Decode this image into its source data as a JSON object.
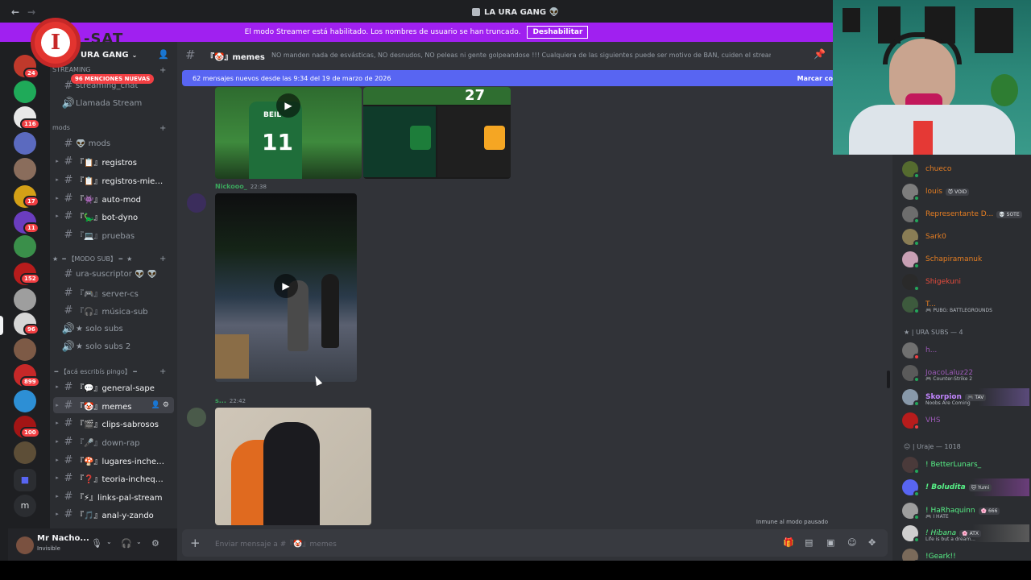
{
  "window": {
    "title": "LA URA GANG 👽"
  },
  "streamer_banner": {
    "text": "El modo Streamer está habilitado. Los nombres de usuario se han truncado.",
    "button": "Deshabilitar"
  },
  "logo": {
    "mark": "I",
    "text": "-SAT"
  },
  "servers": [
    {
      "badge": "24"
    },
    {
      "badge": ""
    },
    {
      "badge": "116"
    },
    {
      "badge": ""
    },
    {
      "badge": ""
    },
    {
      "badge": "17"
    },
    {
      "badge": "11"
    },
    {
      "badge": ""
    },
    {
      "badge": "152"
    },
    {
      "badge": ""
    },
    {
      "badge": "96"
    },
    {
      "badge": ""
    },
    {
      "badge": "899"
    },
    {
      "badge": ""
    },
    {
      "badge": "100"
    },
    {
      "badge": ""
    },
    {
      "badge": ""
    },
    {
      "badge": "m"
    }
  ],
  "server_name": "URA GANG",
  "mentions_pill": "96 MENCIONES NUEVAS",
  "categories": {
    "streaming": "STREAMING",
    "mods": "mods",
    "modo_sub": "★ ╺╸【MODO SUB】╺╸ ★",
    "aca": "╺╸【acá escribís pingo】╺╸"
  },
  "channels": {
    "streaming_chat": "streaming_chat",
    "llamada": "Llamada Stream",
    "mods": "👽 mods",
    "registros": "『📋』registros",
    "registros_miem": "『📋』registros-miem...",
    "auto_mod": "『👾』auto-mod",
    "bot_dyno": "『🦕』bot-dyno",
    "pruebas": "『💻』pruebas",
    "ura_suscriptor": "ura-suscriptor 👽 👽",
    "server_cs": "『🎮』server-cs",
    "musica_sub": "『🎧』música-sub",
    "solo_subs": "★ solo subs",
    "solo_subs_2": "★ solo subs 2",
    "general_sape": "『💬』general-sape",
    "memes": "『🤡』memes",
    "clips": "『🎬』clips-sabrosos",
    "down_rap": "『🎤』down-rap",
    "lugares": "『🍄』lugares-inchequ...",
    "teoria": "『❓』teoria-inchequea...",
    "links": "『⚡』links-pal-stream",
    "anal": "『🎵』anal-y-zando"
  },
  "user": {
    "name": "Mr Nacho...",
    "status": "Invisible"
  },
  "channel_header": {
    "name": "『🤡』memes",
    "topic": "NO manden nada de esvásticas, NO desnudos, NO peleas ni gente golpeandose !!! Cualquiera de las siguientes puede ser motivo de BAN, cuiden el stream!"
  },
  "new_messages_bar": {
    "text": "62 mensajes nuevos desde las 9:34 del 19 de marzo de 2026",
    "action": "Marcar co"
  },
  "messages": [
    {
      "author": "Nickooo_",
      "time": "22:38"
    },
    {
      "author": "s...",
      "time": "22:42"
    }
  ],
  "video_overlay": {
    "jersey_number": "11",
    "jersey_name": "BEIL",
    "score_number": "27"
  },
  "slowmode": "Inmune al modo pausado",
  "composer": {
    "placeholder": "Enviar mensaje a #『🤡』memes"
  },
  "members": [
    {
      "name": "chueco",
      "color": "#e67e22",
      "tag": "",
      "status": ""
    },
    {
      "name": "louis",
      "color": "#e67e22",
      "tag": "😈 VOID",
      "status": ""
    },
    {
      "name": "Representante D...",
      "color": "#e67e22",
      "tag": "💀 SOTE",
      "status": ""
    },
    {
      "name": "Sark0",
      "color": "#e67e22",
      "tag": "",
      "status": ""
    },
    {
      "name": "Schapiramanuk",
      "color": "#e67e22",
      "tag": "",
      "status": ""
    },
    {
      "name": "Shigekuni",
      "color": "#e74c3c",
      "tag": "",
      "status": ""
    },
    {
      "name": "T...",
      "color": "#e67e22",
      "tag": "",
      "status": "🎮 PUBG: BATTLEGROUNDS"
    }
  ],
  "group_subs": "★ | URA SUBS — 4",
  "subs": [
    {
      "name": "h...",
      "color": "#9b59b6",
      "tag": "",
      "status": ""
    },
    {
      "name": "JoacoLaluz22",
      "color": "#9b59b6",
      "tag": "",
      "status": "🎮 Counter-Strike 2"
    },
    {
      "name": "Skorpion",
      "color": "#c084fc",
      "tag": "🎮 TAV",
      "status": "Noobs Are Coming"
    },
    {
      "name": "VHS",
      "color": "#9b59b6",
      "tag": "",
      "status": ""
    }
  ],
  "group_uraje": "😐 | Uraje — 1018",
  "uraje": [
    {
      "name": "! BetterLunars_",
      "color": "#57f287",
      "tag": "",
      "status": ""
    },
    {
      "name": "! Boludita",
      "color": "#57f287",
      "tag": "🐱 Yumi",
      "status": ""
    },
    {
      "name": "! HaRhaquinn",
      "color": "#57f287",
      "tag": "🌸 666",
      "status": "🎮 I HATE"
    },
    {
      "name": "! Hibana",
      "color": "#57f287",
      "tag": "🌸 ATX",
      "status": "Life is but a dream..."
    },
    {
      "name": "!Geark!!",
      "color": "#57f287",
      "tag": "",
      "status": ""
    }
  ],
  "colors": {
    "blurple": "#5865f2",
    "banner": "#a020f0",
    "red_badge": "#f23f43"
  }
}
